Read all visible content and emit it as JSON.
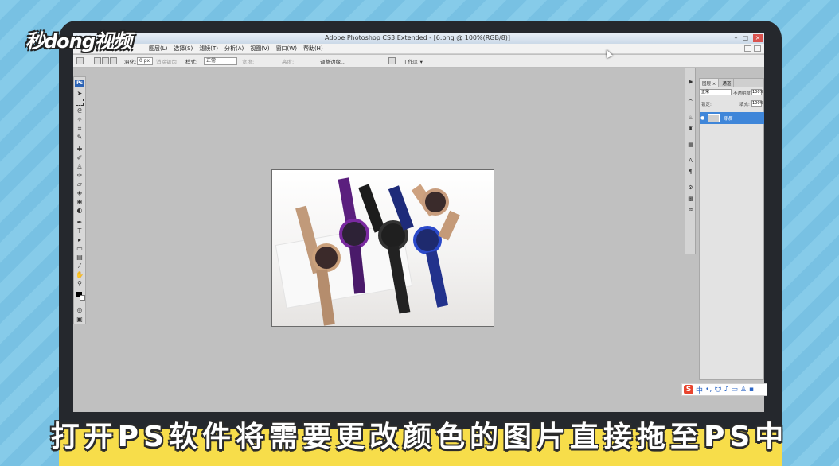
{
  "watermark": "秒dong视频",
  "window": {
    "title": "Adobe Photoshop CS3 Extended - [6.png @ 100%(RGB/8)]",
    "controls": [
      "–",
      "□",
      "×"
    ]
  },
  "menu": [
    "图层(L)",
    "选择(S)",
    "滤镜(T)",
    "分析(A)",
    "视图(V)",
    "窗口(W)",
    "帮助(H)"
  ],
  "options": {
    "feather_label": "羽化:",
    "feather_value": "0 px",
    "antialias_label": "消除锯齿",
    "style_label": "样式:",
    "style_value": "正常",
    "width_label": "宽度:",
    "height_label": "高度:",
    "refine_edge": "调整边缘...",
    "workspace": "工作区 ▾"
  },
  "layers": {
    "tab_layers": "图层 ×",
    "tab_channels": "通道",
    "blend_mode": "正常",
    "opacity_label": "不透明度:",
    "opacity_value": "100%",
    "lock_label": "锁定:",
    "fill_label": "填充:",
    "fill_value": "100%",
    "layer_name": "背景"
  },
  "ime": {
    "logo": "S",
    "mode": "中"
  },
  "subtitle": "打开PS软件将需要更改颜色的图片直接拖至PS中",
  "colors": {
    "background": "#7ec6e6",
    "monitor": "#25282d",
    "subtitle_band": "#f7dd4a",
    "layer_selected": "#3f86d9"
  }
}
